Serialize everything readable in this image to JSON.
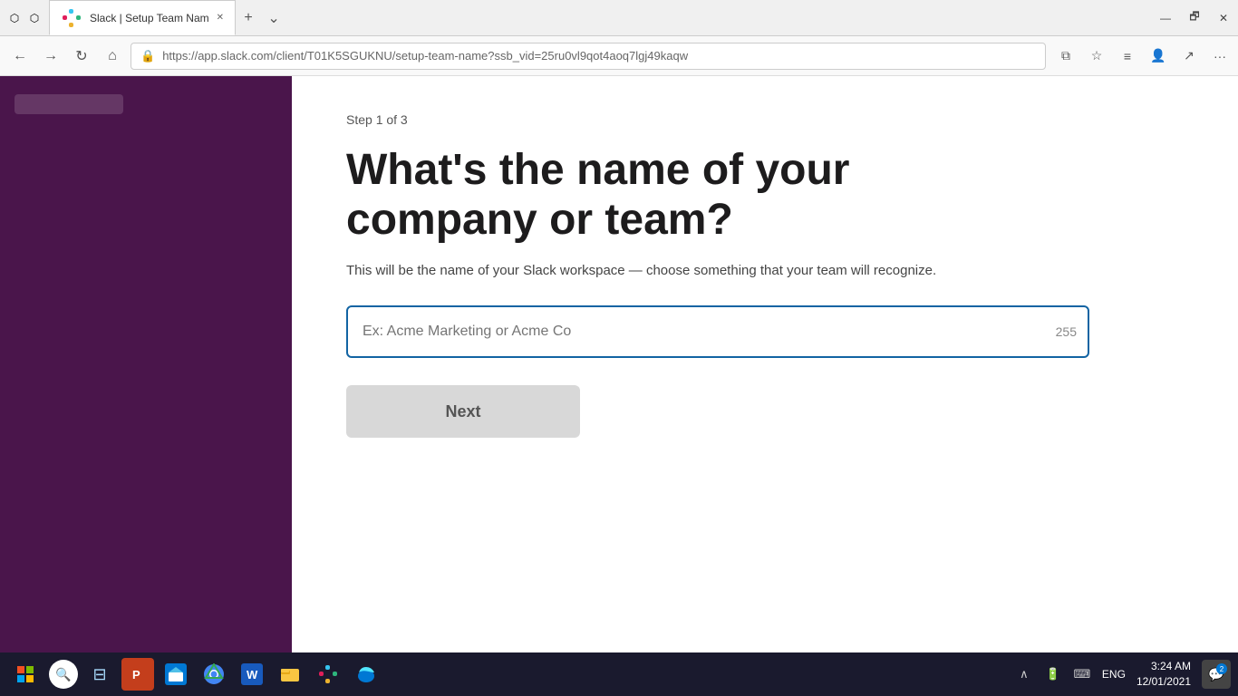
{
  "browser": {
    "titlebar": {
      "favicon": "🟣",
      "tab_title": "Slack | Setup Team Nam",
      "close_label": "✕",
      "new_tab_label": "+",
      "dropdown_label": "⌄",
      "minimize_label": "—",
      "maximize_label": "🗗",
      "close_window_label": "✕"
    },
    "addressbar": {
      "url_display": "https://app.slack.com/client/T01K5SGUKNU/setup-team-name?ssb_vid=25ru0vl9qot4aoq7lgj49kaqw",
      "url_prefix": "https://",
      "url_main": "app.slack.com",
      "url_suffix": "/client/T01K5SGUKNU/setup-team-name?ssb_vid=25ru0vl9qot4aoq7lgj49kaqw",
      "back_label": "←",
      "forward_label": "→",
      "refresh_label": "↻",
      "home_label": "⌂",
      "lock_label": "🔒",
      "bookmark_label": "☆",
      "settings_label": "⚙",
      "profile_label": "👤",
      "share_label": "↗",
      "more_label": "···"
    }
  },
  "page": {
    "step_label": "Step 1 of 3",
    "heading_line1": "What's the name of your",
    "heading_line2": "company or team?",
    "description": "This will be the name of your Slack workspace — choose something that your team will recognize.",
    "input_placeholder": "Ex: Acme Marketing or Acme Co",
    "char_count": "255",
    "next_button_label": "Next"
  },
  "taskbar": {
    "start_icon": "⊞",
    "search_icon": "🔍",
    "time": "3:24 AM",
    "date": "12/01/2021",
    "lang": "ENG",
    "notification_count": "2",
    "apps": [
      {
        "name": "task-view",
        "icon": "⊟"
      },
      {
        "name": "powerpoint",
        "icon": "P"
      },
      {
        "name": "store",
        "icon": "🛍"
      },
      {
        "name": "chrome",
        "icon": "⊙"
      },
      {
        "name": "word",
        "icon": "W"
      },
      {
        "name": "explorer",
        "icon": "📁"
      },
      {
        "name": "slack",
        "icon": "S"
      },
      {
        "name": "edge",
        "icon": "e"
      }
    ]
  }
}
